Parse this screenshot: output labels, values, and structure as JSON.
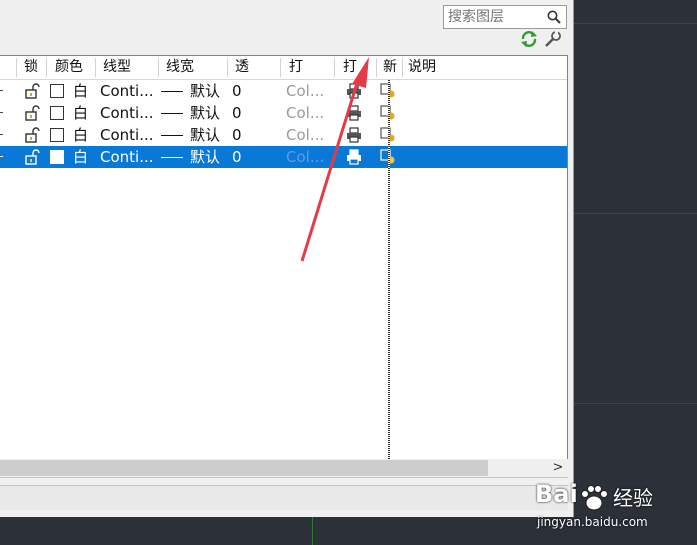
{
  "search": {
    "placeholder": "搜索图层"
  },
  "header": {
    "lock": "锁",
    "color": "颜色",
    "linetype": "线型",
    "lineweight": "线宽",
    "transparency": "透",
    "plot_style": "打",
    "plot": "打",
    "new_vp_freeze": "新",
    "description": "说明"
  },
  "rows": [
    {
      "color_name": "白",
      "linetype": "Conti...",
      "lineweight": "默认",
      "transparency": "0",
      "plot_style": "Col...",
      "selected": false
    },
    {
      "color_name": "白",
      "linetype": "Conti...",
      "lineweight": "默认",
      "transparency": "0",
      "plot_style": "Col...",
      "selected": false
    },
    {
      "color_name": "白",
      "linetype": "Conti...",
      "lineweight": "默认",
      "transparency": "0",
      "plot_style": "Col...",
      "selected": false
    },
    {
      "color_name": "白",
      "linetype": "Conti...",
      "lineweight": "默认",
      "transparency": "0",
      "plot_style": "Col...",
      "selected": true
    }
  ],
  "scrollbar": {
    "right_arrow": ">"
  },
  "watermark": {
    "brand": "Bai",
    "brand_cn": "经验",
    "url": "jingyan.baidu.com"
  },
  "colors": {
    "selection": "#0a78d6",
    "annotation_arrow": "#e53b46",
    "refresh_green": "#2e9e2e"
  }
}
